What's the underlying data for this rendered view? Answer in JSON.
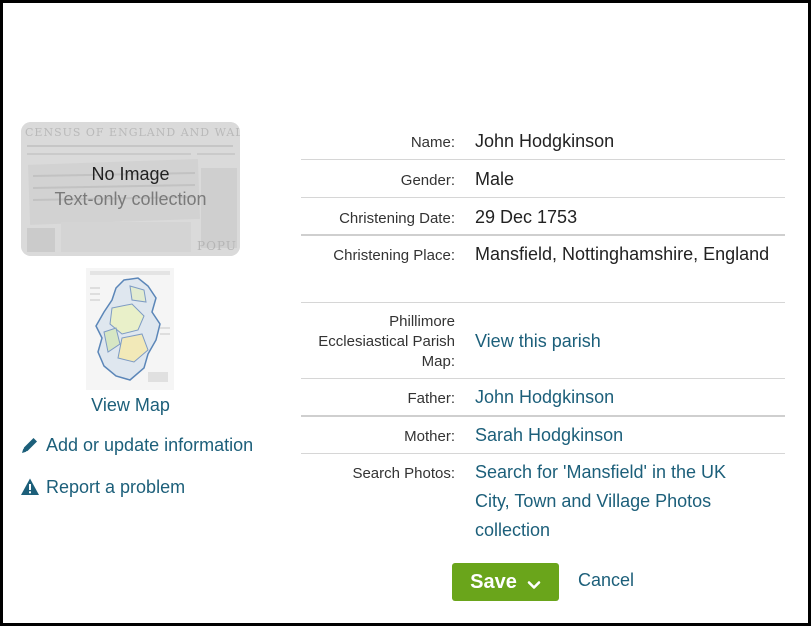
{
  "image_panel": {
    "no_image": "No Image",
    "subtitle": "Text-only collection"
  },
  "map": {
    "view_map": "View Map"
  },
  "actions": {
    "add_update": "Add or update information",
    "report": "Report a problem"
  },
  "record": {
    "name_label": "Name:",
    "name_value": "John Hodgkinson",
    "gender_label": "Gender:",
    "gender_value": "Male",
    "christening_date_label": "Christening Date:",
    "christening_date_value": "29 Dec 1753",
    "christening_place_label": "Christening Place:",
    "christening_place_value": "Mansfield, Nottinghamshire, England",
    "parish_map_label": "Phillimore Ecclesiastical Parish Map:",
    "parish_map_value": "View this parish",
    "father_label": "Father:",
    "father_value": "John Hodgkinson",
    "mother_label": "Mother:",
    "mother_value": "Sarah Hodgkinson",
    "search_photos_label": "Search Photos:",
    "search_photos_value": "Search for 'Mansfield' in the UK City, Town and Village Photos collection"
  },
  "buttons": {
    "save": "Save",
    "cancel": "Cancel"
  },
  "colors": {
    "link": "#1c5f7a",
    "save_button": "#6aa51b",
    "border": "#000000"
  }
}
